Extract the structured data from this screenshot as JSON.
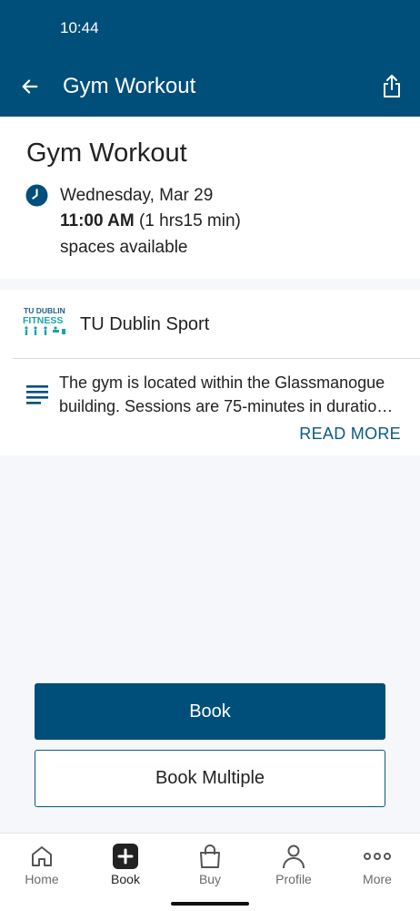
{
  "status_bar": {
    "time": "10:44"
  },
  "app_bar": {
    "title": "Gym Workout"
  },
  "event": {
    "title": "Gym Workout",
    "date": "Wednesday, Mar 29",
    "time": "11:00 AM",
    "duration": "(1 hrs15 min)",
    "availability": "spaces available"
  },
  "provider": {
    "logo_text_top": "TU DUBLIN",
    "logo_text_mid": "FITNESS",
    "name": "TU Dublin Sport"
  },
  "description": {
    "line1": "The gym is located within the Glassmanogue",
    "line2": "building. Sessions are 75-minutes in duratio…",
    "read_more": "READ MORE"
  },
  "actions": {
    "book_label": "Book",
    "book_multiple_label": "Book Multiple"
  },
  "bottom_nav": {
    "items": [
      {
        "label": "Home",
        "icon": "home-icon"
      },
      {
        "label": "Book",
        "icon": "plus-box-icon"
      },
      {
        "label": "Buy",
        "icon": "shopping-bag-icon"
      },
      {
        "label": "Profile",
        "icon": "person-icon"
      },
      {
        "label": "More",
        "icon": "more-dots-icon"
      }
    ],
    "active_index": 1
  },
  "colors": {
    "brand": "#004f7a",
    "accent_text": "#0a5a84",
    "logo_teal": "#1aa3a8"
  }
}
